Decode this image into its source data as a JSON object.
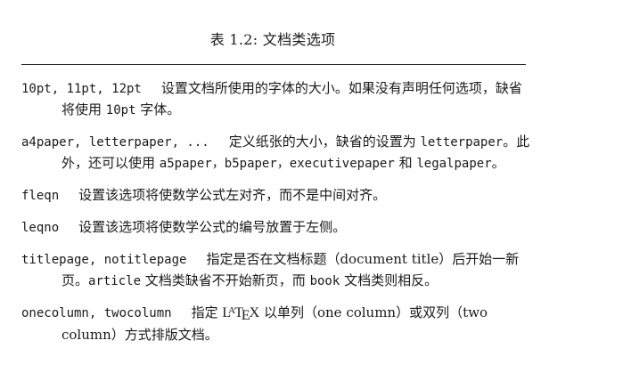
{
  "table_caption": "表 1.2: 文档类选项",
  "options": [
    {
      "term": "10pt, 11pt, 12pt",
      "desc_1": "设置文档所使用的字体的大小。如果没有声明任何选项，缺省将使用 ",
      "code_1": "10pt",
      "desc_2": " 字体。"
    },
    {
      "term": "a4paper, letterpaper, ...",
      "desc_1": "定义纸张的大小，缺省的设置为 ",
      "code_1": "letterpaper",
      "desc_2": "。此外，还可以使用 ",
      "code_2": "a5paper，b5paper，executivepaper",
      "desc_3": " 和 ",
      "code_3": "legalpaper",
      "desc_4": "。"
    },
    {
      "term": "fleqn",
      "desc_1": "设置该选项将使数学公式左对齐，而不是中间对齐。"
    },
    {
      "term": "leqno",
      "desc_1": "设置该选项将使数学公式的编号放置于左侧。"
    },
    {
      "term": "titlepage, notitlepage",
      "desc_1": "指定是否在文档标题（document title）后开始一新页。",
      "code_1": "article",
      "desc_2": " 文档类缺省不开始新页，而 ",
      "code_2": "book",
      "desc_3": " 文档类则相反。"
    },
    {
      "term": "onecolumn, twocolumn",
      "desc_1": "指定 ",
      "logo_l": "L",
      "logo_a": "A",
      "logo_t": "T",
      "logo_e": "E",
      "logo_x": "X",
      "desc_2": " 以单列（one column）或双列（two column）方式排版文档。"
    }
  ]
}
